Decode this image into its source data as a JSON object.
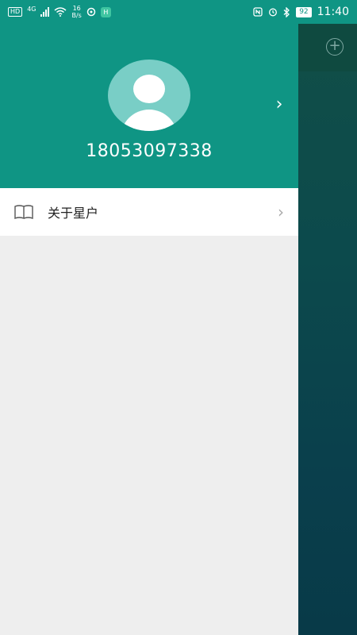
{
  "status_bar": {
    "hd": "HD",
    "network": "4G",
    "speed_value": "16",
    "speed_unit": "B/s",
    "app_badge": "H",
    "battery": "92",
    "time": "11:40"
  },
  "drawer": {
    "phone_number": "18053097338",
    "menu_items": [
      {
        "label": "关于星户",
        "icon": "book-icon"
      }
    ]
  },
  "background_app": {
    "add_icon": "plus-circle-icon",
    "add_symbol": "+"
  },
  "colors": {
    "header": "#0f9584",
    "avatar_bg": "#79cec6",
    "drawer_bg": "#eeeeee"
  }
}
